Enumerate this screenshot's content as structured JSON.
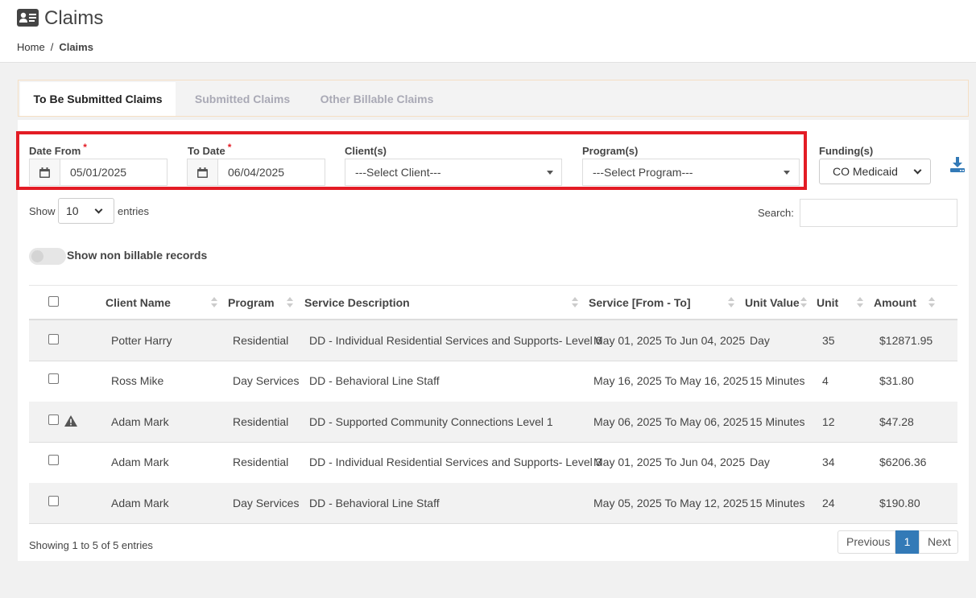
{
  "header": {
    "title": "Claims",
    "icon": "id-card-icon",
    "breadcrumb": {
      "home": "Home",
      "separator": "/",
      "current": "Claims"
    }
  },
  "tabs": [
    {
      "label": "To Be Submitted Claims",
      "active": true
    },
    {
      "label": "Submitted Claims",
      "active": false
    },
    {
      "label": "Other Billable Claims",
      "active": false
    }
  ],
  "filters": {
    "date_from": {
      "label": "Date From",
      "required_mark": "*",
      "value": "05/01/2025",
      "icon": "calendar-icon"
    },
    "to_date": {
      "label": "To Date",
      "required_mark": "*",
      "value": "06/04/2025",
      "icon": "calendar-icon"
    },
    "clients": {
      "label": "Client(s)",
      "value": "---Select Client---"
    },
    "programs": {
      "label": "Program(s)",
      "value": "---Select Program---"
    },
    "funding": {
      "label": "Funding(s)",
      "value": "CO Medicaid"
    },
    "download_icon": "download-icon"
  },
  "table_controls": {
    "show_label": "Show",
    "page_length": "10",
    "entries_label": "entries",
    "search_label": "Search:",
    "search_value": "",
    "toggle_label": "Show non billable records"
  },
  "table": {
    "columns": [
      "Client Name",
      "Program",
      "Service Description",
      "Service [From - To]",
      "Unit Value",
      "Unit",
      "Amount"
    ],
    "rows": [
      {
        "client": "Potter Harry",
        "program": "Residential",
        "description": "DD - Individual Residential Services and Supports- Level 6",
        "service": "May 01, 2025 To Jun 04, 2025",
        "unit_value": "Day",
        "unit": "35",
        "amount": "$12871.95",
        "warning": false
      },
      {
        "client": "Ross Mike",
        "program": "Day Services",
        "description": "DD - Behavioral Line Staff",
        "service": "May 16, 2025 To May 16, 2025",
        "unit_value": "15 Minutes",
        "unit": "4",
        "amount": "$31.80",
        "warning": false
      },
      {
        "client": "Adam Mark",
        "program": "Residential",
        "description": "DD - Supported Community Connections Level 1",
        "service": "May 06, 2025 To May 06, 2025",
        "unit_value": "15 Minutes",
        "unit": "12",
        "amount": "$47.28",
        "warning": true
      },
      {
        "client": "Adam Mark",
        "program": "Residential",
        "description": "DD - Individual Residential Services and Supports- Level 3",
        "service": "May 01, 2025 To Jun 04, 2025",
        "unit_value": "Day",
        "unit": "34",
        "amount": "$6206.36",
        "warning": false
      },
      {
        "client": "Adam Mark",
        "program": "Day Services",
        "description": "DD - Behavioral Line Staff",
        "service": "May 05, 2025 To May 12, 2025",
        "unit_value": "15 Minutes",
        "unit": "24",
        "amount": "$190.80",
        "warning": false
      }
    ]
  },
  "footer": {
    "info": "Showing 1 to 5 of 5 entries",
    "prev": "Previous",
    "current_page": "1",
    "next": "Next"
  },
  "colors": {
    "highlight": "#e31c25",
    "accent": "#337ab7",
    "tab_border": "#f5dfc4",
    "stripe": "#f2f2f2"
  }
}
